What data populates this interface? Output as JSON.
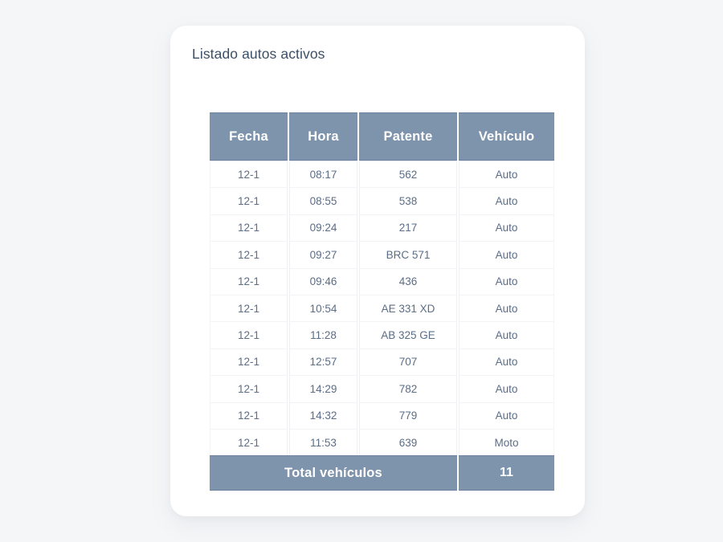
{
  "page": {
    "background_color": "#f5f6f8"
  },
  "card": {
    "title": "Listado autos activos",
    "background_color": "#ffffff",
    "title_color": "#3d4f66"
  },
  "table": {
    "header_bg_color": "#7e93ac",
    "header_text_color": "#ffffff",
    "cell_text_color": "#5b6d87",
    "columns": [
      "Fecha",
      "Hora",
      "Patente",
      "Vehículo"
    ],
    "rows": [
      {
        "fecha": "12-1",
        "hora": "08:17",
        "patente": "562",
        "vehiculo": "Auto"
      },
      {
        "fecha": "12-1",
        "hora": "08:55",
        "patente": "538",
        "vehiculo": "Auto"
      },
      {
        "fecha": "12-1",
        "hora": "09:24",
        "patente": "217",
        "vehiculo": "Auto"
      },
      {
        "fecha": "12-1",
        "hora": "09:27",
        "patente": "BRC 571",
        "vehiculo": "Auto"
      },
      {
        "fecha": "12-1",
        "hora": "09:46",
        "patente": "436",
        "vehiculo": "Auto"
      },
      {
        "fecha": "12-1",
        "hora": "10:54",
        "patente": "AE 331 XD",
        "vehiculo": "Auto"
      },
      {
        "fecha": "12-1",
        "hora": "11:28",
        "patente": "AB 325 GE",
        "vehiculo": "Auto"
      },
      {
        "fecha": "12-1",
        "hora": "12:57",
        "patente": "707",
        "vehiculo": "Auto"
      },
      {
        "fecha": "12-1",
        "hora": "14:29",
        "patente": "782",
        "vehiculo": "Auto"
      },
      {
        "fecha": "12-1",
        "hora": "14:32",
        "patente": "779",
        "vehiculo": "Auto"
      },
      {
        "fecha": "12-1",
        "hora": "11:53",
        "patente": "639",
        "vehiculo": "Moto"
      }
    ],
    "footer": {
      "label": "Total vehículos",
      "value": "11"
    }
  }
}
